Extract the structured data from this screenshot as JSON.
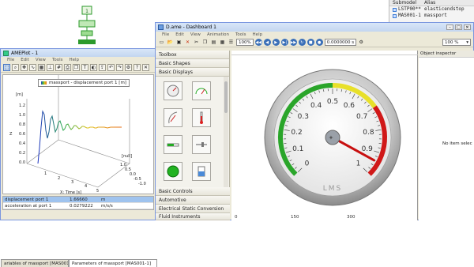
{
  "schematic": {
    "label": "1"
  },
  "submodel_panel": {
    "columns": [
      "Submodel",
      "Alias"
    ],
    "rows": [
      {
        "submodel": "LSTP00**",
        "alias": "elasticendstop"
      },
      {
        "submodel": "MAS001-1",
        "alias": "massport"
      }
    ]
  },
  "ameplot": {
    "title": "AMEPlot - 1",
    "menu": [
      "File",
      "Edit",
      "View",
      "Tools",
      "Help"
    ],
    "legend": "massport - displacement port 1 [m]",
    "axis_labels": {
      "z": "[m]",
      "y_side": "[null]",
      "x_bottom": "X: Time [s]",
      "z_name": "Z"
    },
    "z_ticks": [
      "1.2",
      "1.0",
      "0.8",
      "0.6",
      "0.4",
      "0.2",
      "0.0"
    ],
    "x_ticks": [
      "1",
      "2",
      "3",
      "4",
      "5"
    ],
    "y_ticks": [
      "1.0",
      "0.5",
      "0.0",
      "-0.5",
      "-1.0"
    ],
    "variables": [
      {
        "name": "displacement port 1",
        "value": "1.66660",
        "unit": "m"
      },
      {
        "name": "acceleration at port 1",
        "value": "0.0279222",
        "unit": "m/s/s"
      }
    ],
    "bottom_tabs": [
      "ariables of massport [MAS001-1]",
      "Parameters of massport [MAS001-1]"
    ]
  },
  "dashboard": {
    "title": "D.ame - Dashboard 1",
    "menu": [
      "File",
      "Edit",
      "View",
      "Animation",
      "Tools",
      "Help"
    ],
    "speed": "100%",
    "time": "0.0000000 s",
    "zoom": "100 %",
    "toolbox_title": "Toolbox",
    "sections_top": [
      "Basic Shapes",
      "Basic Displays"
    ],
    "sections_bottom": [
      "Basic Controls",
      "Automotive",
      "Electrical Static Conversion",
      "Fluid Instruments"
    ],
    "inspector_title": "Object inspector",
    "inspector_empty": "No item selec",
    "ruler_ticks": [
      "0",
      "150",
      "300"
    ],
    "gauge": {
      "labels": [
        "0",
        "0.1",
        "0.2",
        "0.3",
        "0.4",
        "0.5",
        "0.6",
        "0.7",
        "0.8",
        "0.9",
        "1"
      ],
      "brand": "LMS",
      "value": 0.94,
      "min": 0,
      "max": 1,
      "zones": {
        "green": [
          0,
          0.5
        ],
        "yellow": [
          0.5,
          0.7
        ],
        "red": [
          0.7,
          1
        ]
      },
      "colors": {
        "green": "#2aa52a",
        "yellow": "#e8e02a",
        "red": "#d01818",
        "needle": "#c81010"
      }
    }
  }
}
